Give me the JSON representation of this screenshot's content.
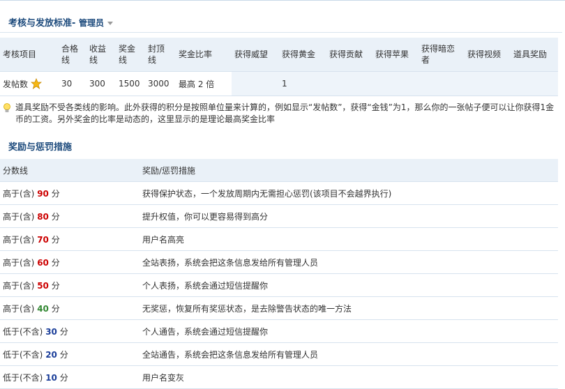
{
  "header": {
    "title": "考核与发放标准",
    "separator": "-",
    "role": "管理员"
  },
  "standards_table": {
    "columns": [
      "考核项目",
      "合格线",
      "收益线",
      "奖金线",
      "封顶线",
      "奖金比率",
      "获得威望",
      "获得黄金",
      "获得贡献",
      "获得苹果",
      "获得暗恋者",
      "获得视频",
      "道具奖励"
    ],
    "row": {
      "item": "发帖数",
      "pass": "30",
      "profit": "300",
      "bonus": "1500",
      "cap": "3000",
      "ratio": "最高 2 倍",
      "prestige": "",
      "gold": "1",
      "contribution": "",
      "apple": "",
      "admirer": "",
      "video": "",
      "item_reward": ""
    }
  },
  "tip": {
    "text": "道具奖励不受各类线的影响。此外获得的积分是按照单位量来计算的，例如显示“发帖数”，获得“金钱”为1，那么你的一张帖子便可以让你获得1金币的工资。另外奖金的比率是动态的，这里显示的是理论最高奖金比率"
  },
  "rewards_section": {
    "title": "奖励与惩罚措施",
    "col_score": "分数线",
    "col_measure": "奖励/惩罚措施",
    "rows": [
      {
        "prefix": "高于(含)",
        "score": "90",
        "unit": "分",
        "measure": "获得保护状态，一个发放周期内无需担心惩罚(该项目不会越界执行)"
      },
      {
        "prefix": "高于(含)",
        "score": "80",
        "unit": "分",
        "measure": "提升权值，你可以更容易得到高分"
      },
      {
        "prefix": "高于(含)",
        "score": "70",
        "unit": "分",
        "measure": "用户名高亮"
      },
      {
        "prefix": "高于(含)",
        "score": "60",
        "unit": "分",
        "measure": "全站表扬，系统会把这条信息发给所有管理人员"
      },
      {
        "prefix": "高于(含)",
        "score": "50",
        "unit": "分",
        "measure": "个人表扬，系统会通过短信提醒你"
      },
      {
        "prefix": "高于(含)",
        "score": "40",
        "unit": "分",
        "measure": "无奖惩，恢复所有奖惩状态，是去除警告状态的唯一方法"
      },
      {
        "prefix": "低于(不含)",
        "score": "30",
        "unit": "分",
        "measure": "个人通告，系统会通过短信提醒你"
      },
      {
        "prefix": "低于(不含)",
        "score": "20",
        "unit": "分",
        "measure": "全站通告，系统会把这条信息发给所有管理人员"
      },
      {
        "prefix": "低于(不含)",
        "score": "10",
        "unit": "分",
        "measure": "用户名变灰"
      }
    ]
  },
  "colors": {
    "score_high": "#cc0000",
    "score_neutral": "#338833",
    "score_low": "#1a3d99",
    "header_bg": "#eaf1f8",
    "title": "#1c4a7c"
  },
  "icons": {
    "item_icon": "star-icon",
    "tip_icon": "lightbulb-icon",
    "role_caret": "chevron-down-icon"
  }
}
